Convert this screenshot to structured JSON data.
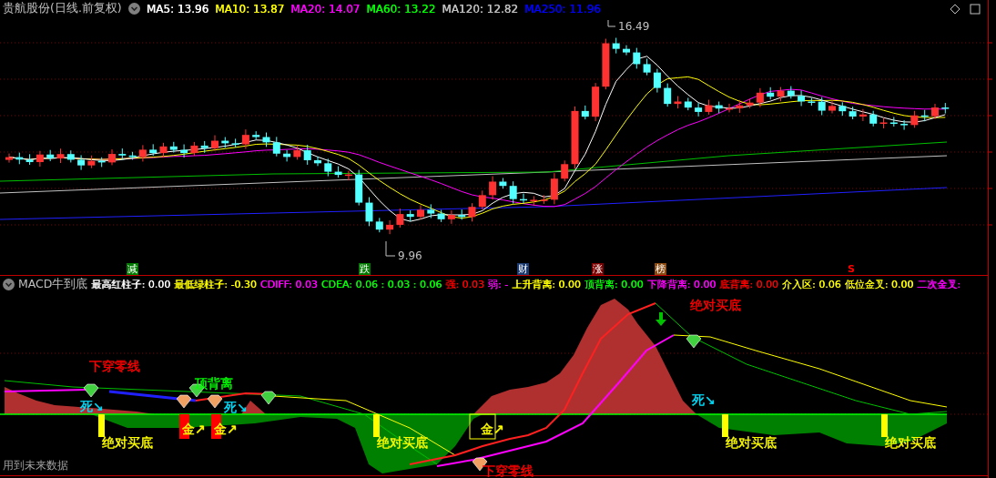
{
  "stock_header": {
    "title": "贵航股份(日线.前复权)",
    "indicators": [
      {
        "label": "MA5: 13.96",
        "color": "#ffffff"
      },
      {
        "label": "MA10: 13.87",
        "color": "#ffff00"
      },
      {
        "label": "MA20: 14.07",
        "color": "#ff00ff"
      },
      {
        "label": "MA60: 13.22",
        "color": "#00ff00"
      },
      {
        "label": "MA120: 12.82",
        "color": "#c0c0c0"
      },
      {
        "label": "MA250: 11.96",
        "color": "#0000ff"
      }
    ]
  },
  "price_chart": {
    "high_label": "16.49",
    "low_label": "9.96"
  },
  "event_markers": [
    {
      "label": "减",
      "kind": "badge",
      "color": "#007a00"
    },
    {
      "label": "跌",
      "kind": "badge",
      "color": "#007a00"
    },
    {
      "label": "财",
      "kind": "badge",
      "color": "#1a3a70"
    },
    {
      "label": "涨",
      "kind": "badge",
      "color": "#7a0000"
    },
    {
      "label": "榜",
      "kind": "badge",
      "color": "#8a4a10"
    },
    {
      "label": "S",
      "kind": "letter",
      "color": "#ff0000"
    }
  ],
  "macd_header": {
    "title": "MACD牛到底",
    "indicators": [
      {
        "label": "最高红柱子: 0.00",
        "color": "#ffffff"
      },
      {
        "label": "最低绿柱子: -0.30",
        "color": "#ffff00"
      },
      {
        "label": "CDIFF: 0.03",
        "color": "#ff00ff"
      },
      {
        "label": "CDEA: 0.06 : 0.03 : 0.06",
        "color": "#00ff00"
      },
      {
        "label": "强: 0.03",
        "color": "#ff0000"
      },
      {
        "label": "弱: -",
        "color": "#ff00ff"
      },
      {
        "label": "上升背离: 0.00",
        "color": "#ffff00"
      },
      {
        "label": "顶背离: 0.00",
        "color": "#00ff00"
      },
      {
        "label": "下降背离: 0.00",
        "color": "#ff00ff"
      },
      {
        "label": "底背离: 0.00",
        "color": "#ff0000"
      },
      {
        "label": "介入区: 0.06",
        "color": "#ffff00"
      },
      {
        "label": "低位金叉: 0.00",
        "color": "#ffff00"
      },
      {
        "label": "二次金叉:",
        "color": "#ff00ff"
      }
    ]
  },
  "macd_annotations": [
    {
      "text": "绝对买底",
      "kind": "text",
      "color": "#ff0000"
    },
    {
      "text": "下穿零线",
      "kind": "text",
      "color": "#ff0000"
    },
    {
      "text": "顶背离",
      "kind": "text",
      "color": "#00ff00"
    },
    {
      "text": "死↘",
      "kind": "text",
      "color": "#00e0ff"
    },
    {
      "text": "死↘",
      "kind": "text",
      "color": "#00e0ff"
    },
    {
      "text": "死↘",
      "kind": "text",
      "color": "#00e0ff"
    },
    {
      "text": "绝对买底",
      "kind": "buy-bar",
      "color": "#ffff00"
    },
    {
      "text": "金↗",
      "kind": "gold-bar",
      "color": "#ffff00"
    },
    {
      "text": "金↗",
      "kind": "gold-bar",
      "color": "#ffff00"
    },
    {
      "text": "绝对买底",
      "kind": "buy-bar",
      "color": "#ffff00"
    },
    {
      "text": "金↗",
      "kind": "gold-box",
      "color": "#ffff00"
    },
    {
      "text": "下穿零线",
      "kind": "text",
      "color": "#ff0000"
    },
    {
      "text": "绝对买底",
      "kind": "buy-bar",
      "color": "#ffff00"
    },
    {
      "text": "绝对买底",
      "kind": "buy-bar",
      "color": "#ffff00"
    }
  ],
  "footer_note": "用到未来数据"
}
